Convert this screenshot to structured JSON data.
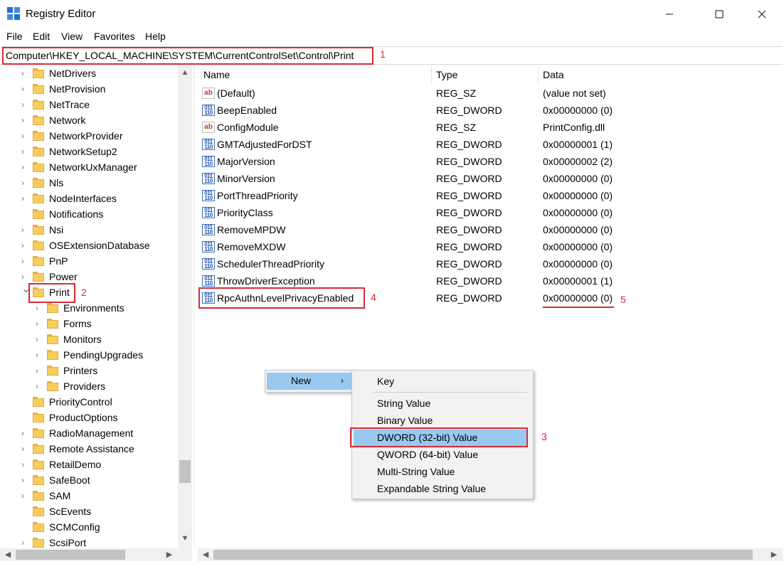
{
  "window": {
    "title": "Registry Editor"
  },
  "menubar": [
    "File",
    "Edit",
    "View",
    "Favorites",
    "Help"
  ],
  "address": "Computer\\HKEY_LOCAL_MACHINE\\SYSTEM\\CurrentControlSet\\Control\\Print",
  "tree": [
    {
      "label": "NetDrivers",
      "indent": 0,
      "expanded": false
    },
    {
      "label": "NetProvision",
      "indent": 0,
      "expanded": false
    },
    {
      "label": "NetTrace",
      "indent": 0,
      "expanded": false
    },
    {
      "label": "Network",
      "indent": 0,
      "expanded": false
    },
    {
      "label": "NetworkProvider",
      "indent": 0,
      "expanded": false
    },
    {
      "label": "NetworkSetup2",
      "indent": 0,
      "expanded": false
    },
    {
      "label": "NetworkUxManager",
      "indent": 0,
      "expanded": false
    },
    {
      "label": "Nls",
      "indent": 0,
      "expanded": false
    },
    {
      "label": "NodeInterfaces",
      "indent": 0,
      "expanded": false
    },
    {
      "label": "Notifications",
      "indent": 0,
      "expanded": false,
      "noArrow": true
    },
    {
      "label": "Nsi",
      "indent": 0,
      "expanded": false
    },
    {
      "label": "OSExtensionDatabase",
      "indent": 0,
      "expanded": false
    },
    {
      "label": "PnP",
      "indent": 0,
      "expanded": false
    },
    {
      "label": "Power",
      "indent": 0,
      "expanded": false
    },
    {
      "label": "Print",
      "indent": 0,
      "expanded": true,
      "selected": true
    },
    {
      "label": "Environments",
      "indent": 1,
      "expanded": false
    },
    {
      "label": "Forms",
      "indent": 1,
      "expanded": false
    },
    {
      "label": "Monitors",
      "indent": 1,
      "expanded": false
    },
    {
      "label": "PendingUpgrades",
      "indent": 1,
      "expanded": false
    },
    {
      "label": "Printers",
      "indent": 1,
      "expanded": false
    },
    {
      "label": "Providers",
      "indent": 1,
      "expanded": false
    },
    {
      "label": "PriorityControl",
      "indent": 0,
      "expanded": false,
      "noArrow": true
    },
    {
      "label": "ProductOptions",
      "indent": 0,
      "expanded": false,
      "noArrow": true
    },
    {
      "label": "RadioManagement",
      "indent": 0,
      "expanded": false
    },
    {
      "label": "Remote Assistance",
      "indent": 0,
      "expanded": false
    },
    {
      "label": "RetailDemo",
      "indent": 0,
      "expanded": false
    },
    {
      "label": "SafeBoot",
      "indent": 0,
      "expanded": false
    },
    {
      "label": "SAM",
      "indent": 0,
      "expanded": false
    },
    {
      "label": "ScEvents",
      "indent": 0,
      "expanded": false,
      "noArrow": true
    },
    {
      "label": "SCMConfig",
      "indent": 0,
      "expanded": false,
      "noArrow": true
    },
    {
      "label": "ScsiPort",
      "indent": 0,
      "expanded": false
    }
  ],
  "columns": {
    "name": "Name",
    "type": "Type",
    "data": "Data"
  },
  "values": [
    {
      "name": "(Default)",
      "type": "REG_SZ",
      "data": "(value not set)",
      "kind": "sz"
    },
    {
      "name": "BeepEnabled",
      "type": "REG_DWORD",
      "data": "0x00000000 (0)",
      "kind": "dw"
    },
    {
      "name": "ConfigModule",
      "type": "REG_SZ",
      "data": "PrintConfig.dll",
      "kind": "sz"
    },
    {
      "name": "GMTAdjustedForDST",
      "type": "REG_DWORD",
      "data": "0x00000001 (1)",
      "kind": "dw"
    },
    {
      "name": "MajorVersion",
      "type": "REG_DWORD",
      "data": "0x00000002 (2)",
      "kind": "dw"
    },
    {
      "name": "MinorVersion",
      "type": "REG_DWORD",
      "data": "0x00000000 (0)",
      "kind": "dw"
    },
    {
      "name": "PortThreadPriority",
      "type": "REG_DWORD",
      "data": "0x00000000 (0)",
      "kind": "dw"
    },
    {
      "name": "PriorityClass",
      "type": "REG_DWORD",
      "data": "0x00000000 (0)",
      "kind": "dw"
    },
    {
      "name": "RemoveMPDW",
      "type": "REG_DWORD",
      "data": "0x00000000 (0)",
      "kind": "dw"
    },
    {
      "name": "RemoveMXDW",
      "type": "REG_DWORD",
      "data": "0x00000000 (0)",
      "kind": "dw"
    },
    {
      "name": "SchedulerThreadPriority",
      "type": "REG_DWORD",
      "data": "0x00000000 (0)",
      "kind": "dw"
    },
    {
      "name": "ThrowDriverException",
      "type": "REG_DWORD",
      "data": "0x00000001 (1)",
      "kind": "dw"
    },
    {
      "name": "RpcAuthnLevelPrivacyEnabled",
      "type": "REG_DWORD",
      "data": "0x00000000 (0)",
      "kind": "dw"
    }
  ],
  "context_menu": {
    "new_label": "New"
  },
  "submenu": {
    "key": "Key",
    "items": [
      "String Value",
      "Binary Value",
      "DWORD (32-bit) Value",
      "QWORD (64-bit) Value",
      "Multi-String Value",
      "Expandable String Value"
    ]
  },
  "markers": [
    "1",
    "2",
    "3",
    "4",
    "5"
  ],
  "colors": {
    "highlight": "#99c9ef",
    "annotation": "#d62c35"
  }
}
